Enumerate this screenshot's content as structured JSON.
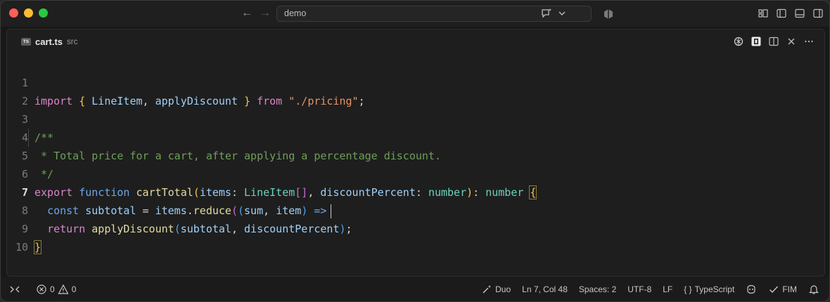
{
  "titlebar": {
    "search_text": "demo"
  },
  "tab": {
    "badge": "TS",
    "name": "cart.ts",
    "path": "src"
  },
  "code": {
    "line_numbers": [
      "1",
      "2",
      "3",
      "4",
      "5",
      "6",
      "7",
      "8",
      "9",
      "10"
    ],
    "active_line": "7"
  },
  "status": {
    "errors": "0",
    "warnings": "0",
    "duo": "Duo",
    "position": "Ln 7, Col 48",
    "spaces": "Spaces: 2",
    "encoding": "UTF-8",
    "eol": "LF",
    "lang_braces": "{ }",
    "language": "TypeScript",
    "fim": "FIM"
  },
  "colors": {
    "keyword": "#d985c9",
    "identifier": "#9ed0f8",
    "function": "#e3dba2",
    "type": "#6ad2bd",
    "string": "#e3936b",
    "comment": "#6e9f57"
  }
}
